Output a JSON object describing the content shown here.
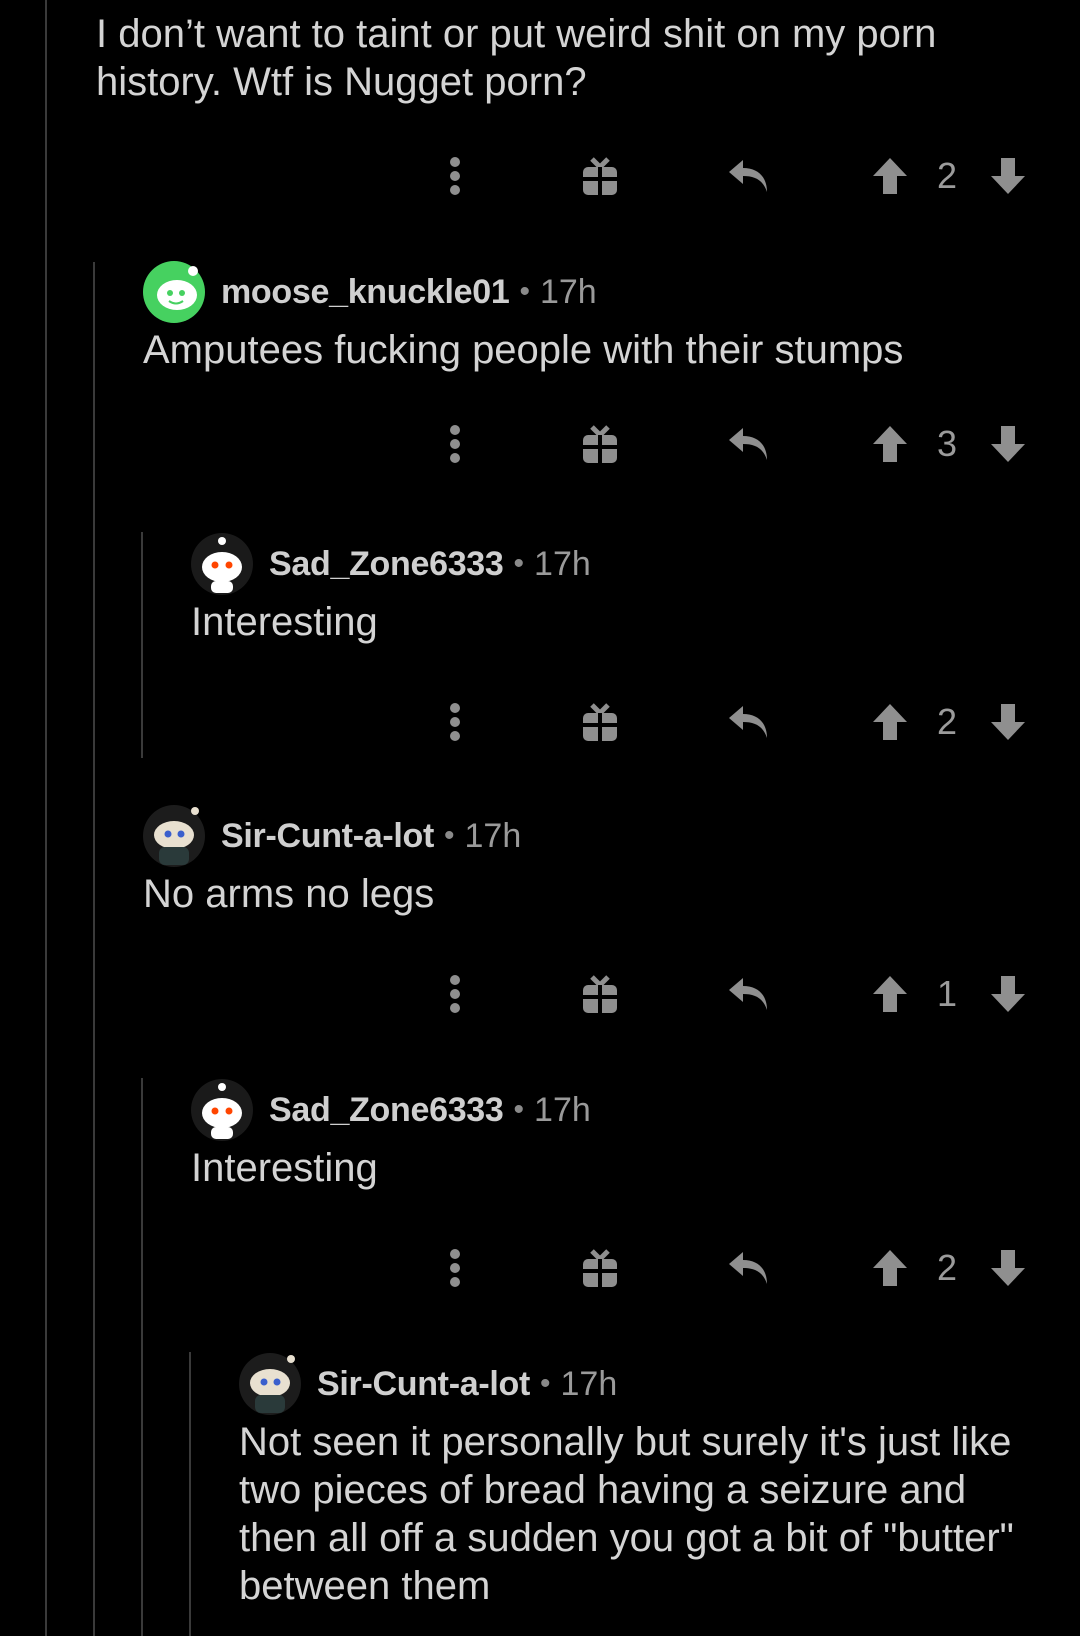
{
  "top_comment": {
    "body": "I don’t want to taint or put weird shit on my porn\nhistory. Wtf is Nugget porn?",
    "score": "2"
  },
  "comments": [
    {
      "username": "moose_knuckle01",
      "separator": "•",
      "time": "17h",
      "body": "Amputees fucking people with their stumps",
      "score": "3",
      "avatar_color": "#46d160"
    },
    {
      "username": "Sad_Zone6333",
      "separator": "•",
      "time": "17h",
      "body": "Interesting",
      "score": "2",
      "avatar_color": "#ffffff"
    },
    {
      "username": "Sir-Cunt-a-lot",
      "separator": "•",
      "time": "17h",
      "body": "No arms no legs",
      "score": "1",
      "avatar_color": "#e8e0d0"
    },
    {
      "username": "Sad_Zone6333",
      "separator": "•",
      "time": "17h",
      "body": "Interesting",
      "score": "2",
      "avatar_color": "#ffffff"
    },
    {
      "username": "Sir-Cunt-a-lot",
      "separator": "•",
      "time": "17h",
      "body": "Not seen it personally but surely it's just like\ntwo pieces of bread having a seizure and\nthen all off a sudden you got a bit of \"butter\"\nbetween them",
      "score": "",
      "avatar_color": "#e8e0d0"
    }
  ],
  "icons": {
    "more": "more-vertical-icon",
    "award": "gift-icon",
    "reply": "reply-icon",
    "upvote": "upvote-arrow-icon",
    "downvote": "downvote-arrow-icon"
  },
  "colors": {
    "background": "#000000",
    "icon": "#8f8f8f",
    "thread_line": "#3a3a3a",
    "text": "#d4d4d4"
  }
}
